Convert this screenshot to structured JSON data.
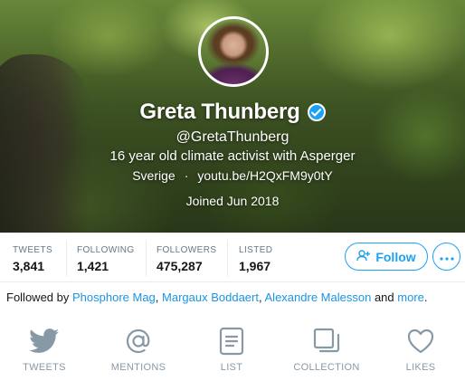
{
  "profile": {
    "name": "Greta Thunberg",
    "handle": "@GretaThunberg",
    "bio": "16 year old climate activist with Asperger",
    "location": "Sverige",
    "separator": "·",
    "website": "youtu.be/H2QxFM9y0tY",
    "joined": "Joined Jun 2018",
    "verified_icon": "verified-badge-icon",
    "avatar_icon": "profile-photo"
  },
  "stats": [
    {
      "label": "TWEETS",
      "value": "3,841"
    },
    {
      "label": "FOLLOWING",
      "value": "1,421"
    },
    {
      "label": "FOLLOWERS",
      "value": "475,287"
    },
    {
      "label": "LISTED",
      "value": "1,967"
    }
  ],
  "actions": {
    "follow_label": "Follow",
    "follow_icon": "add-person-icon",
    "more_icon": "more-dots-icon"
  },
  "followed_by": {
    "prefix": "Followed by",
    "names": [
      "Phosphore Mag",
      "Margaux Boddaert",
      "Alexandre Malesson"
    ],
    "sep1": ",",
    "sep2": ",",
    "and": "and",
    "more": "more",
    "end": "."
  },
  "nav": [
    {
      "label": "TWEETS",
      "icon": "bird-icon"
    },
    {
      "label": "MENTIONS",
      "icon": "at-sign-icon"
    },
    {
      "label": "LIST",
      "icon": "list-icon"
    },
    {
      "label": "COLLECTION",
      "icon": "collection-icon"
    },
    {
      "label": "LIKES",
      "icon": "heart-icon"
    }
  ],
  "colors": {
    "accent": "#1da1f2",
    "link": "#1b95e0",
    "muted": "#8899a6"
  }
}
